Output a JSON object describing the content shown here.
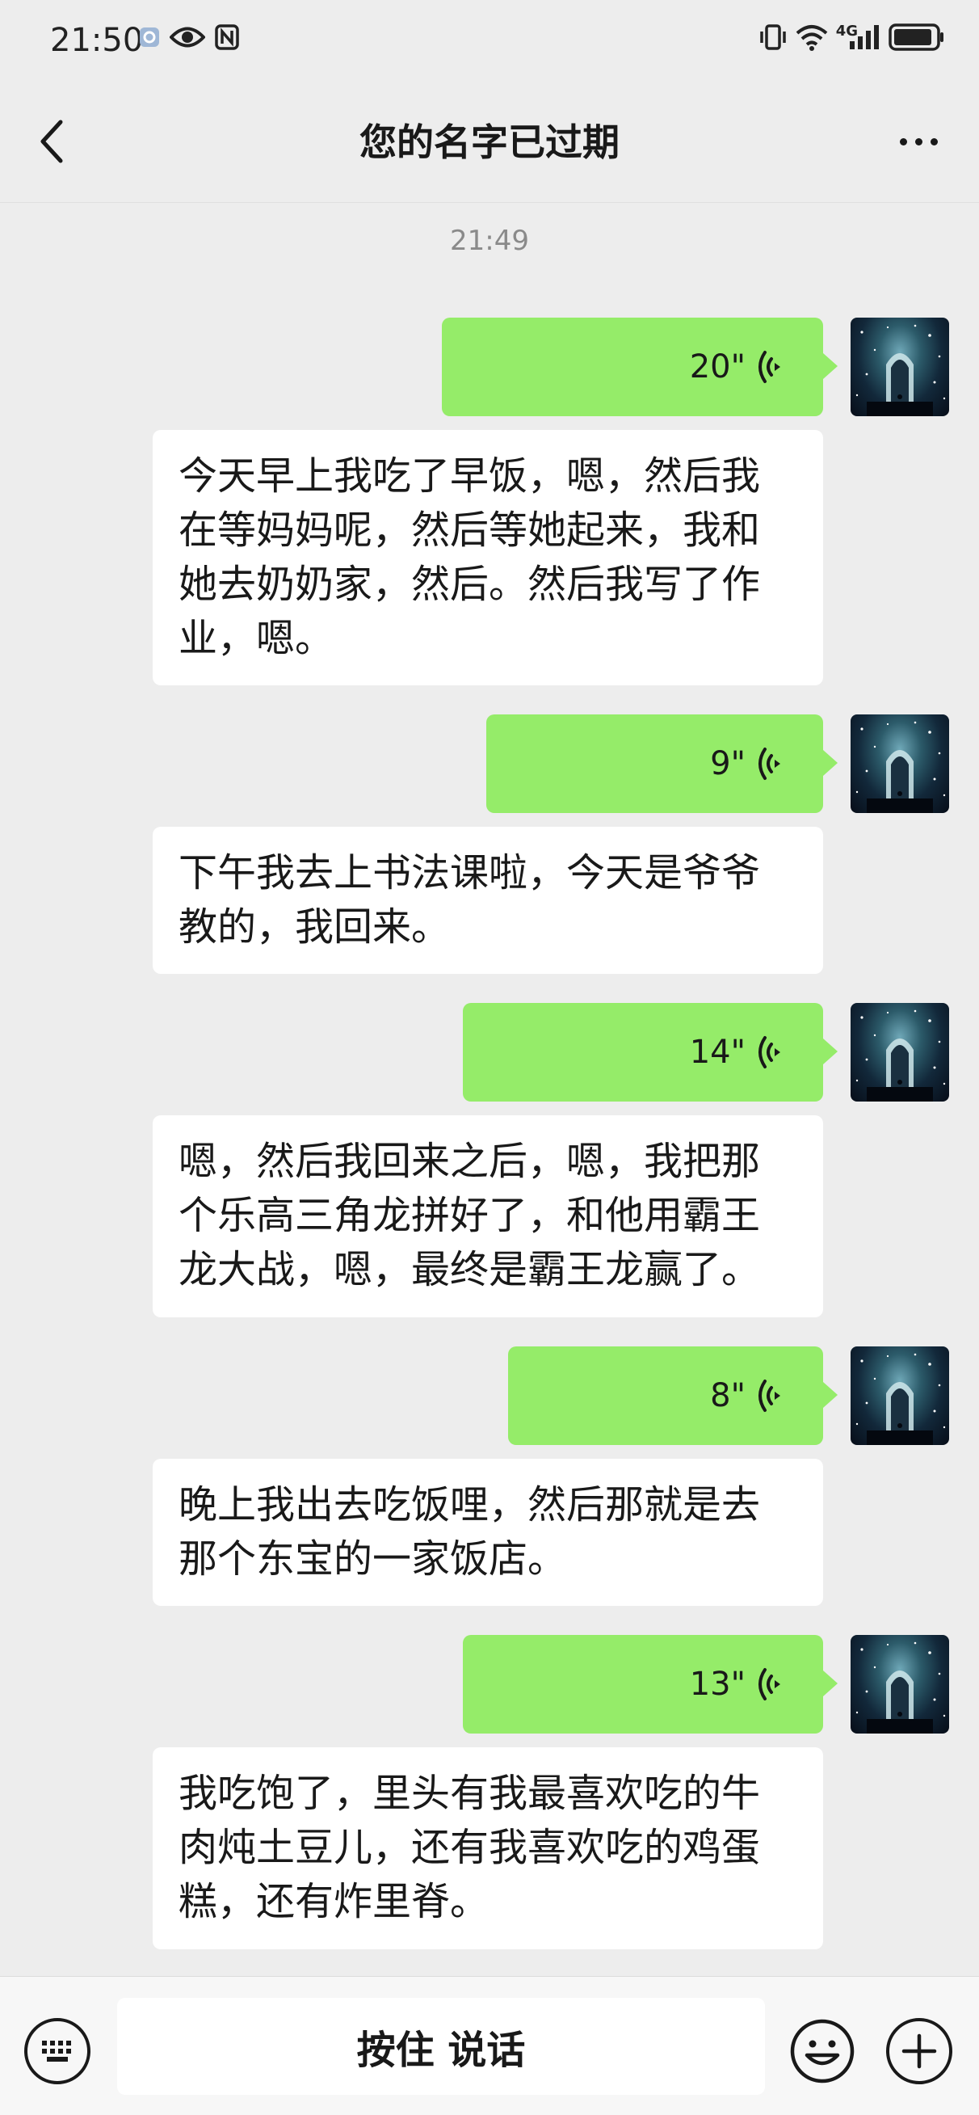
{
  "status_bar": {
    "time": "21:50",
    "left_icons": [
      "app-notification-icon",
      "eye-icon",
      "nfc-icon"
    ],
    "right_icons": [
      "vibrate-icon",
      "wifi-icon",
      "signal-4g-icon",
      "battery-icon"
    ],
    "network": "4G"
  },
  "header": {
    "title": "您的名字已过期",
    "back_icon": "chevron-left-icon",
    "more_icon": "more-dots-icon"
  },
  "chat": {
    "timestamp": "21:49",
    "messages": [
      {
        "duration": "20\"",
        "transcript": "今天早上我吃了早饭，嗯，然后我在等妈妈呢，然后等她起来，我和她去奶奶家，然后。然后我写了作业，嗯。"
      },
      {
        "duration": "9\"",
        "transcript": "下午我去上书法课啦，今天是爷爷教的，我回来。"
      },
      {
        "duration": "14\"",
        "transcript": "嗯，然后我回来之后，嗯，我把那个乐高三角龙拼好了，和他用霸王龙大战，嗯，最终是霸王龙赢了。"
      },
      {
        "duration": "8\"",
        "transcript": "晚上我出去吃饭哩，然后那就是去那个东宝的一家饭店。"
      },
      {
        "duration": "13\"",
        "transcript": "我吃饱了，里头有我最喜欢吃的牛肉炖土豆儿，还有我喜欢吃的鸡蛋糕，还有炸里脊。"
      }
    ]
  },
  "input_bar": {
    "hold_to_talk": "按住 说话",
    "left_icon": "keyboard-icon",
    "emoji_icon": "emoji-icon",
    "plus_icon": "plus-icon"
  },
  "colors": {
    "background": "#ededed",
    "voice_bubble": "#95ec69",
    "transcript_bubble": "#ffffff",
    "text": "#191919",
    "timestamp": "#8a8a8a"
  }
}
